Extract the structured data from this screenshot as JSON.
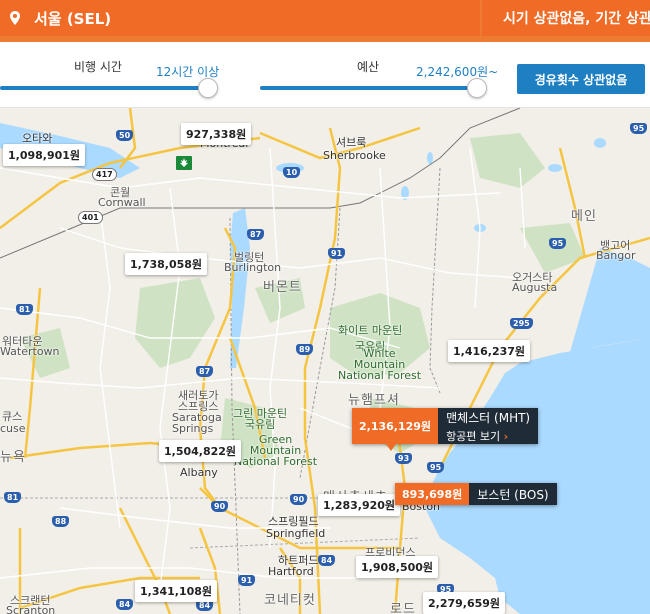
{
  "header": {
    "origin_label": "서울 (SEL)",
    "date_label": "시기 상관없음, 기간 상관없음"
  },
  "filters": {
    "flight_time_label": "비행 시간",
    "flight_time_value": "12시간 이상",
    "flight_time_fraction": 1.0,
    "budget_label": "예산",
    "budget_value": "2,242,600원~",
    "budget_fraction": 1.0,
    "stops_button": "경유횟수 상관없음"
  },
  "colors": {
    "accent": "#ef6b26",
    "blue": "#1e7fc3",
    "water": "#aadaff",
    "dark": "#1f2b36"
  },
  "map": {
    "places": {
      "ottawa": "오타와",
      "montreal": "Montréal",
      "sherbrooke_ko": "셔브룩",
      "sherbrooke_en": "Sherbrooke",
      "cornwall_ko": "콘월",
      "cornwall_en": "Cornwall",
      "maine": "메인",
      "bangor_ko": "뱅고어",
      "bangor_en": "Bangor",
      "augusta_ko": "오거스타",
      "augusta_en": "Augusta",
      "burlington_ko": "벌링턴",
      "burlington_en": "Burlington",
      "vermont": "버몬트",
      "wm_ko": "화이트 마운틴\n국유림",
      "wm_en": "White\nMountain\nNational Forest",
      "watertown_ko": "워터타운",
      "watertown_en": "Watertown",
      "saratoga_ko": "새러토가\n스프링스",
      "saratoga_en": "Saratoga\nSprings",
      "gm_ko": "그린 마운틴\n국유림",
      "gm_en": "Green\nMountain\nNational Forest",
      "nh": "뉴햄프셔",
      "syracuse_ko": "큐스",
      "syracuse_en": "cuse",
      "ny": "뉴욕",
      "albany": "Albany",
      "ma": "매사추세츠",
      "boston": "Boston",
      "springfield_ko": "스프링필드",
      "springfield_en": "Springfield",
      "hartford_ko": "하트퍼드",
      "hartford_en": "Hartford",
      "providence": "프로비던스",
      "ct": "코네티컷",
      "ri": "로드",
      "scranton_ko": "스크랜턴",
      "scranton_en": "Scranton"
    },
    "shields": [
      "50",
      "417",
      "401",
      "10",
      "87",
      "91",
      "95",
      "95",
      "295",
      "81",
      "89",
      "87",
      "93",
      "95",
      "81",
      "90",
      "88",
      "84",
      "84",
      "84",
      "90",
      "91",
      "95"
    ],
    "prices": {
      "p927": "927,338원",
      "p1098": "1,098,901원",
      "p1738": "1,738,058원",
      "p1416": "1,416,237원",
      "p1504": "1,504,822원",
      "p1283": "1,283,920원",
      "p1908": "1,908,500원",
      "p1341": "1,341,108원",
      "p2279": "2,279,659원"
    },
    "destinations": [
      {
        "price": "2,136,129원",
        "name": "맨체스터 (MHT)",
        "link": "항공편 보기",
        "chevron": "›"
      },
      {
        "price": "893,698원",
        "name": "보스턴 (BOS)"
      }
    ]
  }
}
